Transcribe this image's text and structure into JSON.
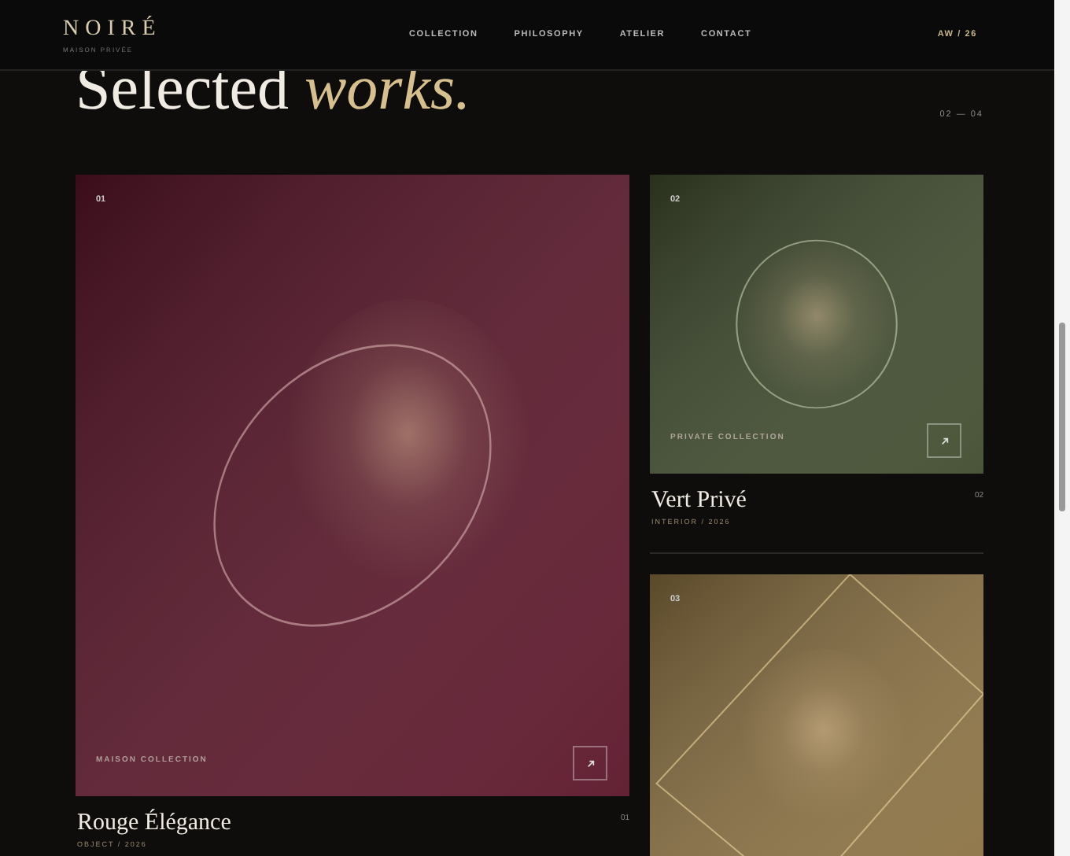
{
  "brand": {
    "name": "NOIRÉ",
    "tagline": "MAISON PRIVÉE"
  },
  "nav": [
    {
      "label": "COLLECTION"
    },
    {
      "label": "PHILOSOPHY"
    },
    {
      "label": "ATELIER"
    },
    {
      "label": "CONTACT"
    }
  ],
  "season": "AW / 26",
  "heading": {
    "plain": "Selected",
    "accent": "works."
  },
  "range": "02 — 04",
  "works": [
    {
      "kind": "ellipse",
      "number": "01",
      "collection": "MAISON COLLECTION",
      "title": "Rouge Élégance",
      "meta": "OBJECT / 2026",
      "index": "01",
      "color": "#5a1428"
    },
    {
      "kind": "circle",
      "number": "02",
      "collection": "PRIVATE COLLECTION",
      "title": "Vert Privé",
      "meta": "INTERIOR / 2026",
      "index": "02",
      "color": "#3e4a2c"
    },
    {
      "kind": "diamond",
      "number": "03",
      "color": "#8a7040"
    }
  ]
}
